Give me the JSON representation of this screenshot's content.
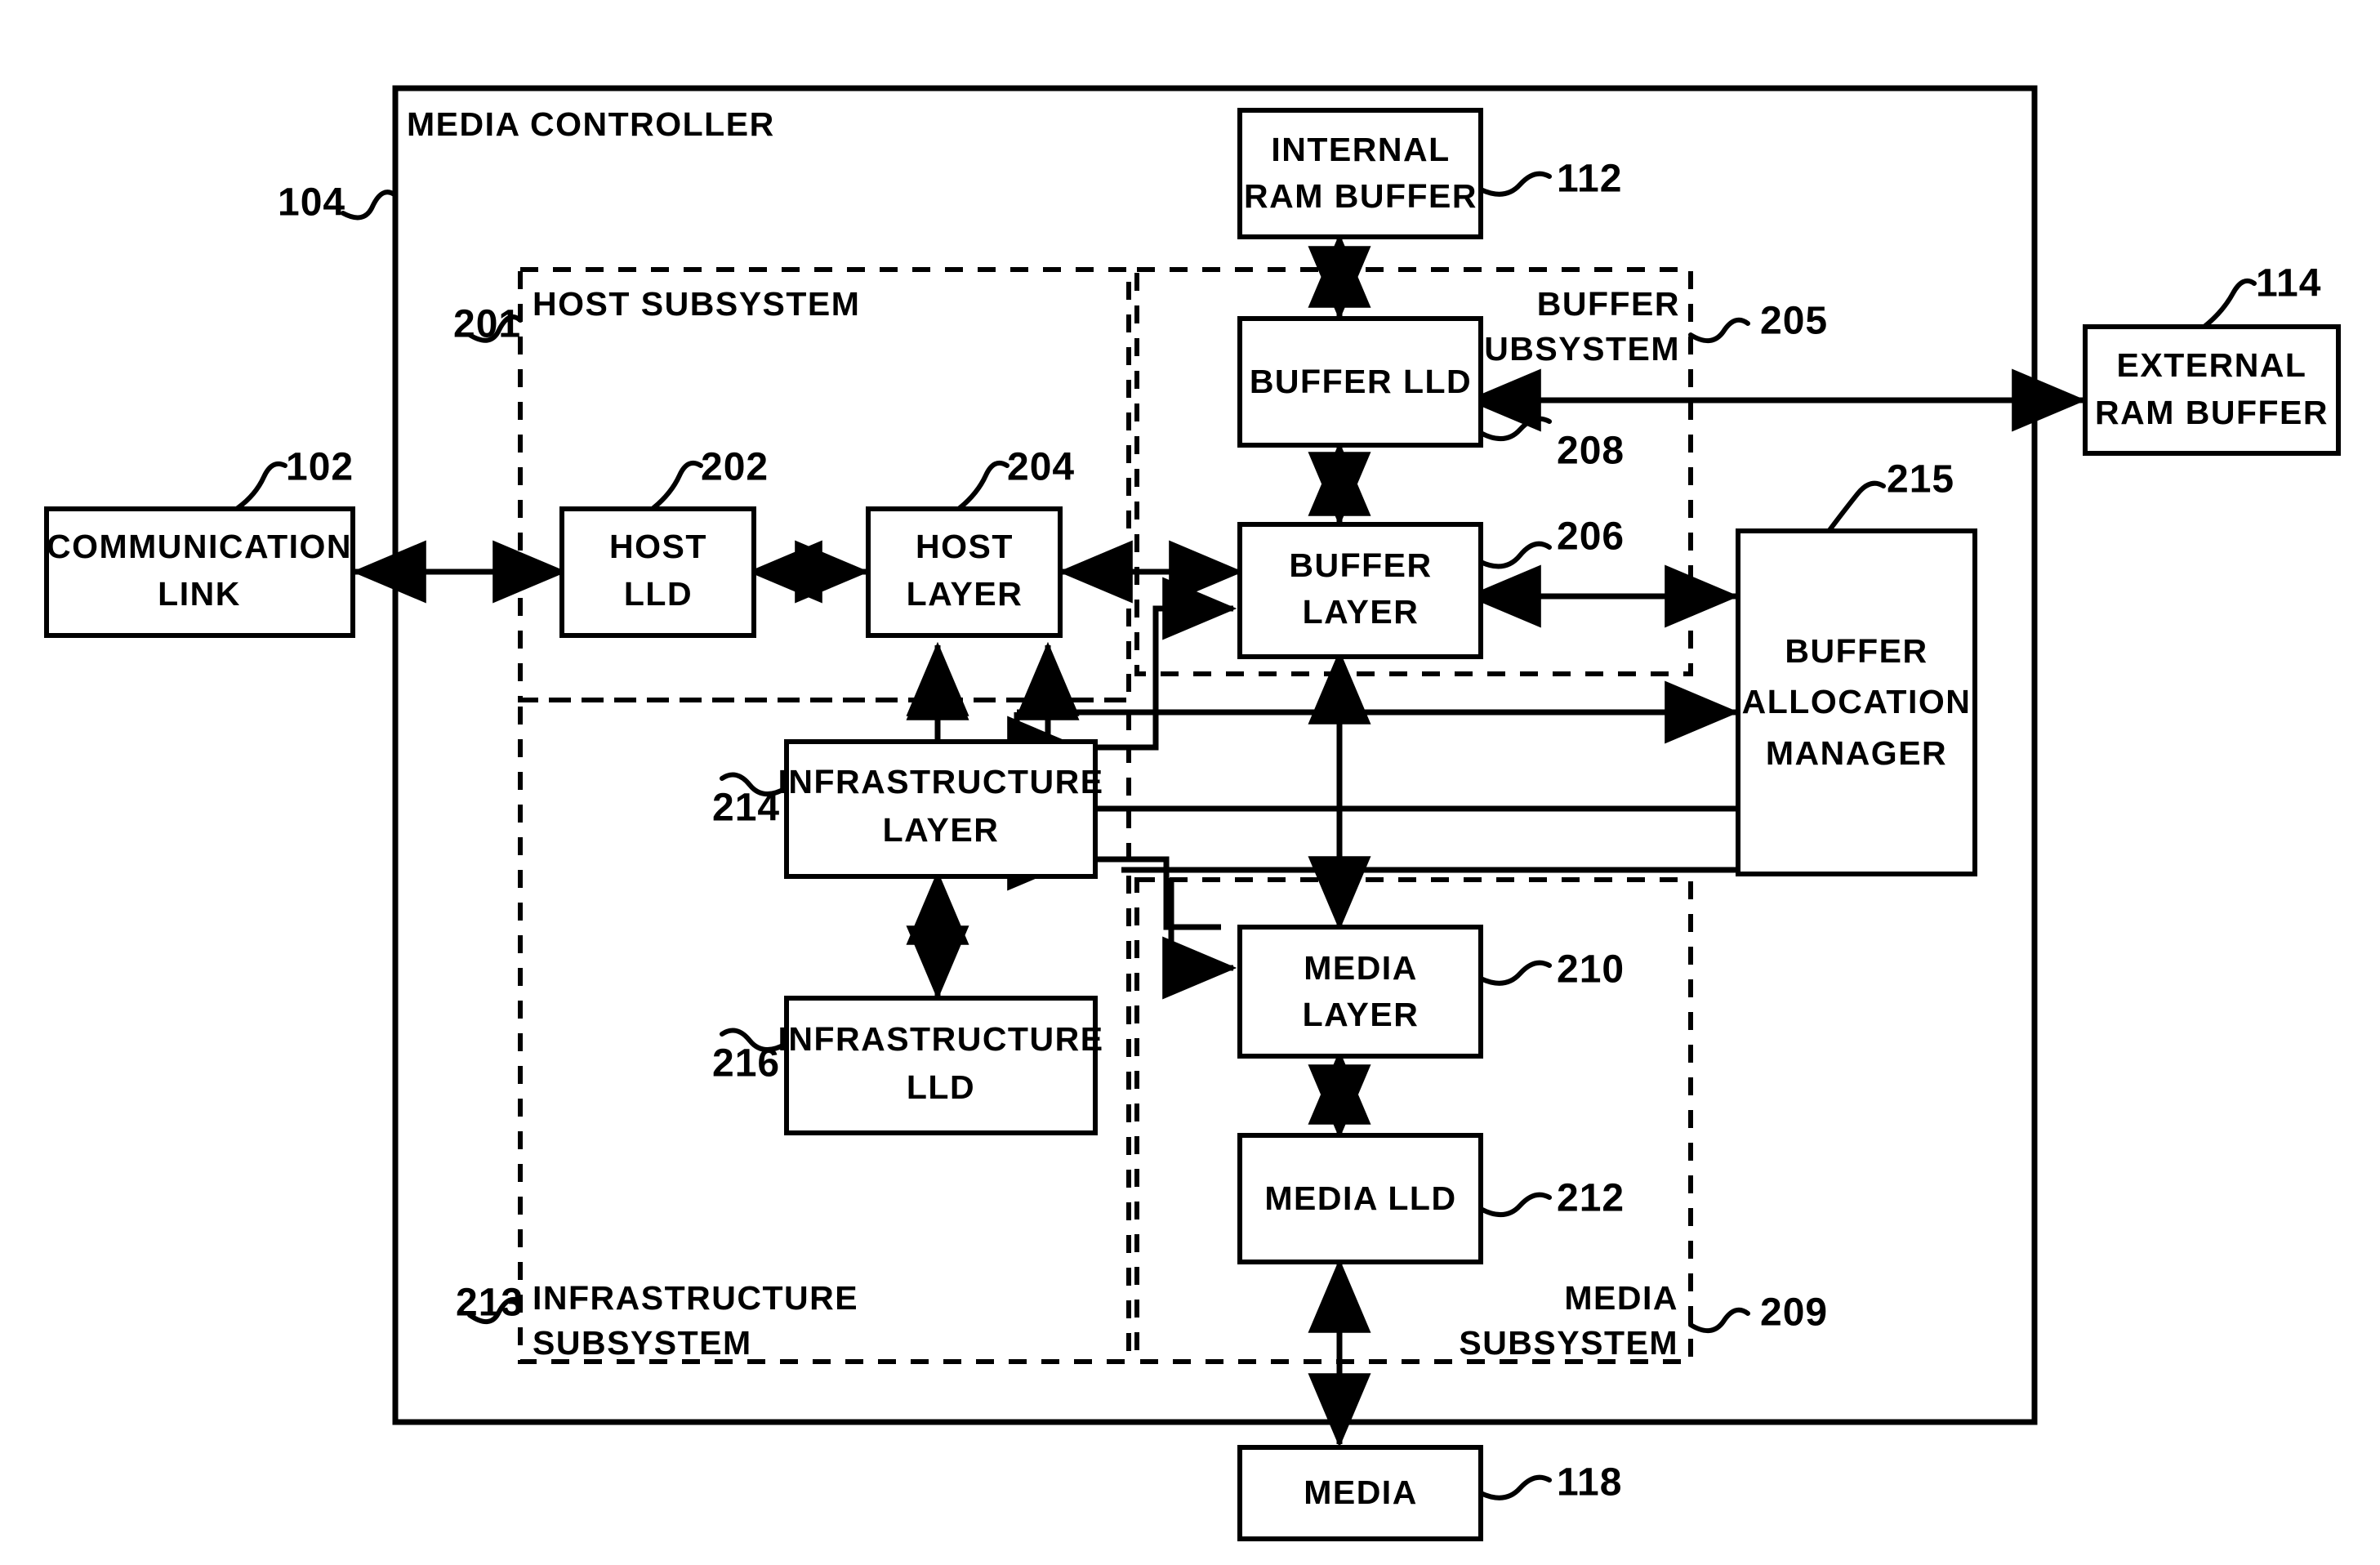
{
  "figure": {
    "type": "patent-block-diagram",
    "outer": {
      "title": "MEDIA CONTROLLER",
      "ref": "104"
    },
    "groups": [
      {
        "id": "host_subsystem",
        "label_line1": "HOST SUBSYSTEM",
        "label_line2": "",
        "ref": "201"
      },
      {
        "id": "buffer_subsystem",
        "label_line1": "BUFFER",
        "label_line2": "SUBSYSTEM",
        "ref": "205"
      },
      {
        "id": "infrastructure_subsystem",
        "label_line1": "INFRASTRUCTURE",
        "label_line2": "SUBSYSTEM",
        "ref": "213"
      },
      {
        "id": "media_subsystem",
        "label_line1": "MEDIA",
        "label_line2": "SUBSYSTEM",
        "ref": "209"
      }
    ],
    "blocks": [
      {
        "id": "communication_link",
        "line1": "COMMUNICATION",
        "line2": "LINK",
        "ref": "102"
      },
      {
        "id": "internal_ram_buffer",
        "line1": "INTERNAL",
        "line2": "RAM  BUFFER",
        "ref": "112"
      },
      {
        "id": "external_ram_buffer",
        "line1": "EXTERNAL",
        "line2": "RAM  BUFFER",
        "ref": "114"
      },
      {
        "id": "host_lld",
        "line1": "HOST",
        "line2": "LLD",
        "ref": "202"
      },
      {
        "id": "host_layer",
        "line1": "HOST",
        "line2": "LAYER",
        "ref": "204"
      },
      {
        "id": "buffer_lld",
        "line1": "BUFFER  LLD",
        "line2": "",
        "ref": "208"
      },
      {
        "id": "buffer_layer",
        "line1": "BUFFER",
        "line2": "LAYER",
        "ref": "206"
      },
      {
        "id": "buffer_allocation_manager",
        "line1": "BUFFER",
        "line2": "ALLOCATION",
        "line3": "MANAGER",
        "ref": "215"
      },
      {
        "id": "infrastructure_layer",
        "line1": "INFRASTRUCTURE",
        "line2": "LAYER",
        "ref": "214"
      },
      {
        "id": "infrastructure_lld",
        "line1": "INFRASTRUCTURE",
        "line2": "LLD",
        "ref": "216"
      },
      {
        "id": "media_layer",
        "line1": "MEDIA",
        "line2": "LAYER",
        "ref": "210"
      },
      {
        "id": "media_lld",
        "line1": "MEDIA  LLD",
        "line2": "",
        "ref": "212"
      },
      {
        "id": "media",
        "line1": "MEDIA",
        "line2": "",
        "ref": "118"
      }
    ],
    "colors": {
      "ink": "#000000",
      "paper": "#ffffff"
    }
  }
}
